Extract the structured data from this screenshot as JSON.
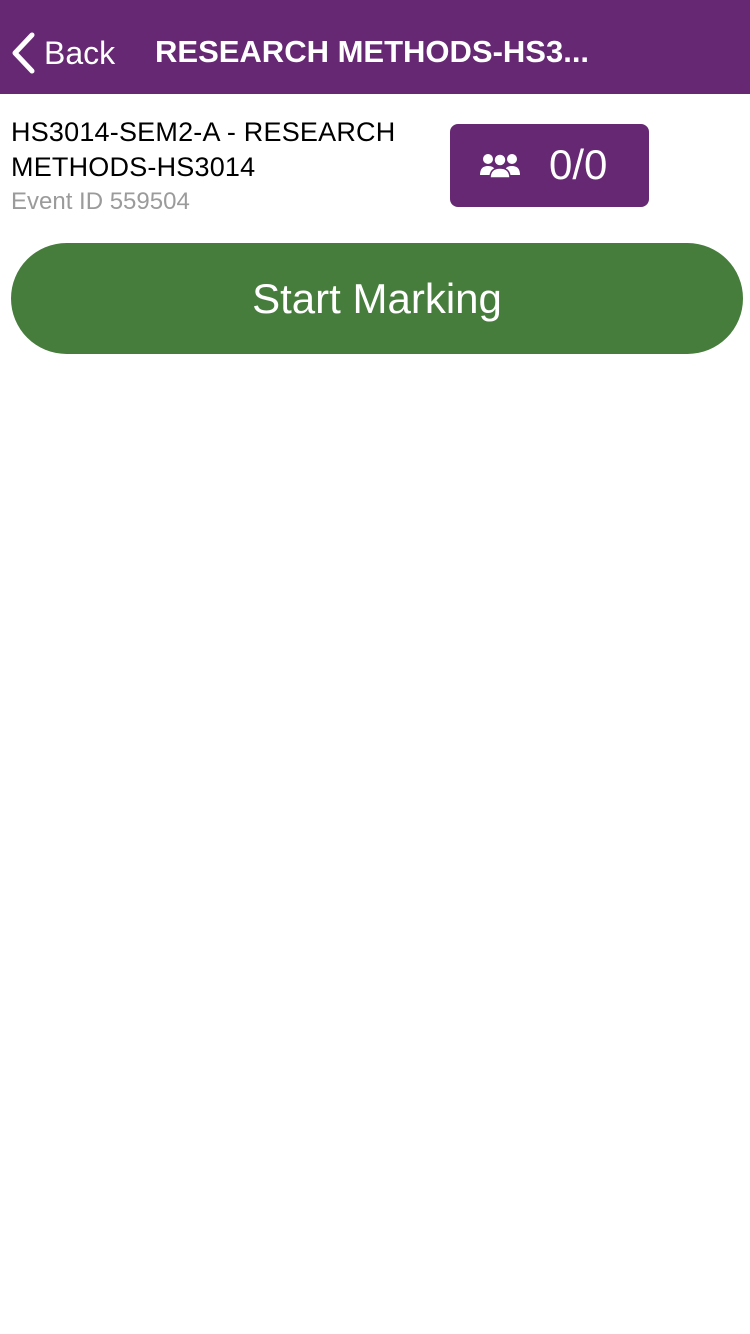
{
  "nav": {
    "back_label": "Back",
    "title": "RESEARCH METHODS-HS3..."
  },
  "event": {
    "course_name": "HS3014-SEM2-A - RESEARCH METHODS-HS3014",
    "event_id_text": "Event ID 559504"
  },
  "counter": {
    "icon": "people-icon",
    "value": "0/0"
  },
  "actions": {
    "start_label": "Start Marking"
  },
  "colors": {
    "nav_background": "#662873",
    "counter_background": "#662873",
    "start_button": "#477d3c",
    "event_id_text": "#9b9b9b"
  }
}
